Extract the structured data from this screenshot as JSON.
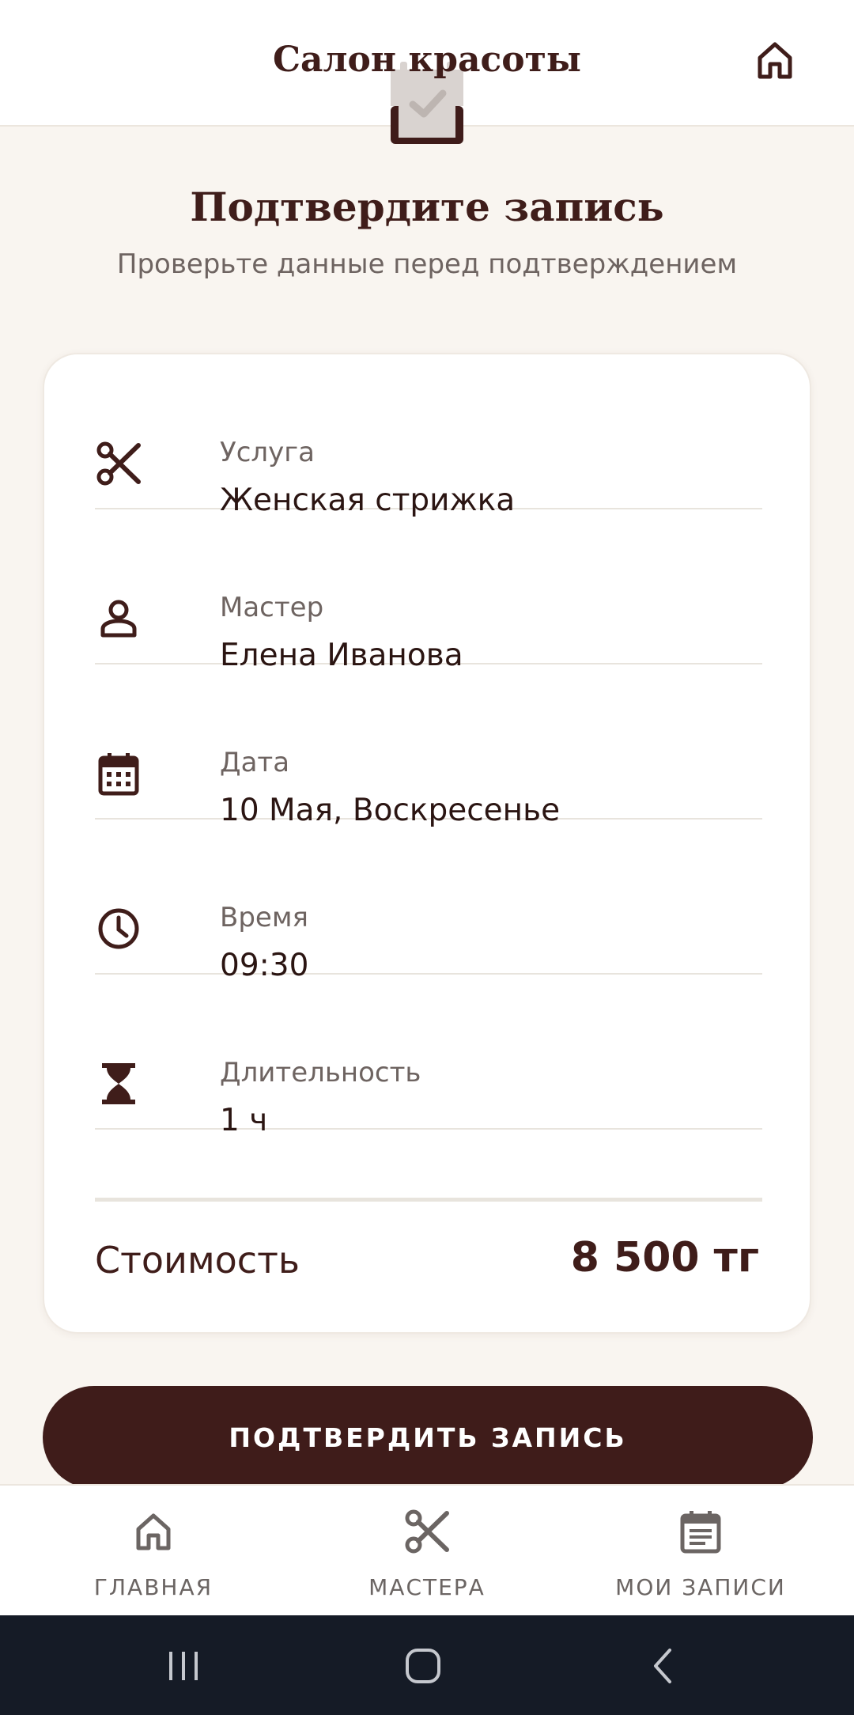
{
  "header": {
    "title": "Салон красоты",
    "home_icon": "home-icon"
  },
  "confirm": {
    "heading": "Подтвердите запись",
    "subtitle": "Проверьте данные перед подтверждением",
    "hero_icon": "calendar-check-icon"
  },
  "details": [
    {
      "icon": "scissors-icon",
      "label": "Услуга",
      "value": "Женская стрижка"
    },
    {
      "icon": "person-icon",
      "label": "Мастер",
      "value": "Елена Иванова"
    },
    {
      "icon": "calendar-icon",
      "label": "Дата",
      "value": "10 Мая, Воскресенье"
    },
    {
      "icon": "clock-icon",
      "label": "Время",
      "value": "09:30"
    },
    {
      "icon": "hourglass-icon",
      "label": "Длительность",
      "value": "1 ч"
    }
  ],
  "price": {
    "label": "Стоимость",
    "value": "8 500 тг"
  },
  "actions": {
    "confirm_label": "ПОДТВЕРДИТЬ ЗАПИСЬ"
  },
  "bottom_nav": [
    {
      "icon": "home-icon",
      "label": "ГЛАВНАЯ"
    },
    {
      "icon": "scissors-icon",
      "label": "МАСТЕРА"
    },
    {
      "icon": "clipboard-list-icon",
      "label": "МОИ ЗАПИСИ"
    }
  ],
  "colors": {
    "brand": "#3f1c1a",
    "background": "#f9f5f0",
    "muted_text": "#6e6461",
    "system_bar": "#151b26"
  }
}
